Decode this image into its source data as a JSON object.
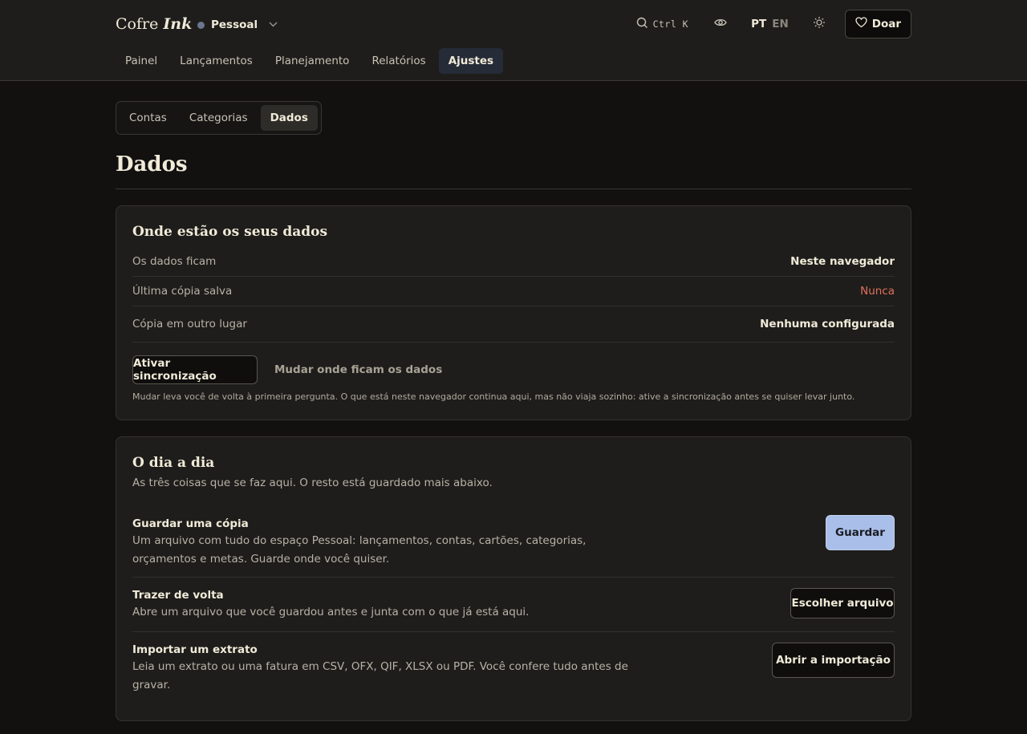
{
  "brand": {
    "name": "Cofre",
    "name_italic": "Ink"
  },
  "space": {
    "name": "Pessoal",
    "dot_color": "#6a7590"
  },
  "header": {
    "search_shortcut": "Ctrl K",
    "icons": [
      "search-icon",
      "eye-icon",
      "sun-icon",
      "heart-icon"
    ],
    "lang_active": "PT",
    "lang_other": "EN",
    "donate_label": "Doar"
  },
  "nav": {
    "tabs": [
      "Painel",
      "Lançamentos",
      "Planejamento",
      "Relatórios",
      "Ajustes"
    ],
    "active": "Ajustes"
  },
  "subnav": {
    "tabs": [
      "Contas",
      "Categorias",
      "Dados"
    ],
    "active": "Dados"
  },
  "page": {
    "title": "Dados"
  },
  "storage_card": {
    "title": "Onde estão os seus dados",
    "rows": [
      {
        "label": "Os dados ficam",
        "value": "Neste navegador"
      },
      {
        "label": "Última cópia salva",
        "value": "Nunca"
      },
      {
        "label": "Cópia em outro lugar",
        "value": "Nenhuma configurada"
      }
    ],
    "sync_button": "Ativar sincronização",
    "change_location_button": "Mudar onde ficam os dados",
    "note": "Mudar leva você de volta à primeira pergunta. O que está neste navegador continua aqui, mas não viaja sozinho: ative a sincronização antes se quiser levar junto."
  },
  "daily_card": {
    "title": "O dia a dia",
    "subtitle": "As três coisas que se faz aqui. O resto está guardado mais abaixo.",
    "actions": [
      {
        "title": "Guardar uma cópia",
        "desc_line1": "Um arquivo com tudo do espaço Pessoal: lançamentos, contas, cartões, categorias,",
        "desc_line2": "orçamentos e metas. Guarde onde você quiser.",
        "button": "Guardar"
      },
      {
        "title": "Trazer de volta",
        "desc_line1": "Abre um arquivo que você guardou antes e junta com o que já está aqui.",
        "button": "Escolher arquivo"
      },
      {
        "title": "Importar um extrato",
        "desc_line1": "Leia um extrato ou uma fatura em CSV, OFX, QIF, XLSX ou PDF. Você confere tudo antes de",
        "desc_line2": "gravar.",
        "button": "Abrir a importação"
      }
    ]
  },
  "colors": {
    "accent": "#a9bee8",
    "warning": "#e0705c",
    "active_tab": "#262b38"
  }
}
